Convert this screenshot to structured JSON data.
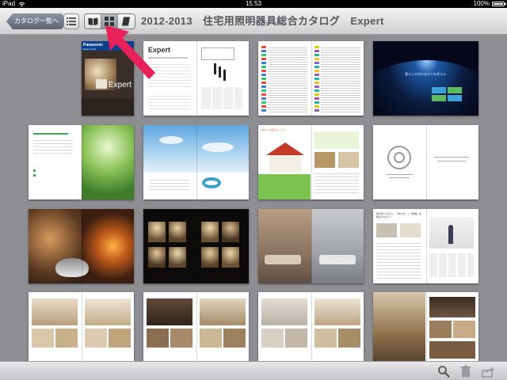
{
  "status_bar": {
    "device": "iPad",
    "time": "15:53",
    "battery": "100%"
  },
  "nav_bar": {
    "back_label": "カタログ一覧へ",
    "title": "2012-2013　住宅用照明器具総合カタログ　Expert"
  },
  "cover": {
    "brand": "Panasonic",
    "subtitle": "ideas for life",
    "title": "Expert"
  },
  "pages": {
    "p2_title": "Expert",
    "p4_text": "暮らしの中のあかりを考える",
    "p9_heading": "あかりで変わる くらし",
    "p11_heading": "家を建てるなら、「省エネ」と「快適」を両立させたい"
  },
  "colors": {
    "accent_arrow": "#e8215a",
    "content_bg": "#8e8e92"
  },
  "icons": {
    "status_wifi": "wifi-icon",
    "status_battery": "battery-icon",
    "list": "list-icon",
    "book": "book-icon",
    "grid": "grid-icon",
    "single_page": "page-icon",
    "search": "search-icon",
    "trash": "trash-icon",
    "share": "share-icon"
  }
}
